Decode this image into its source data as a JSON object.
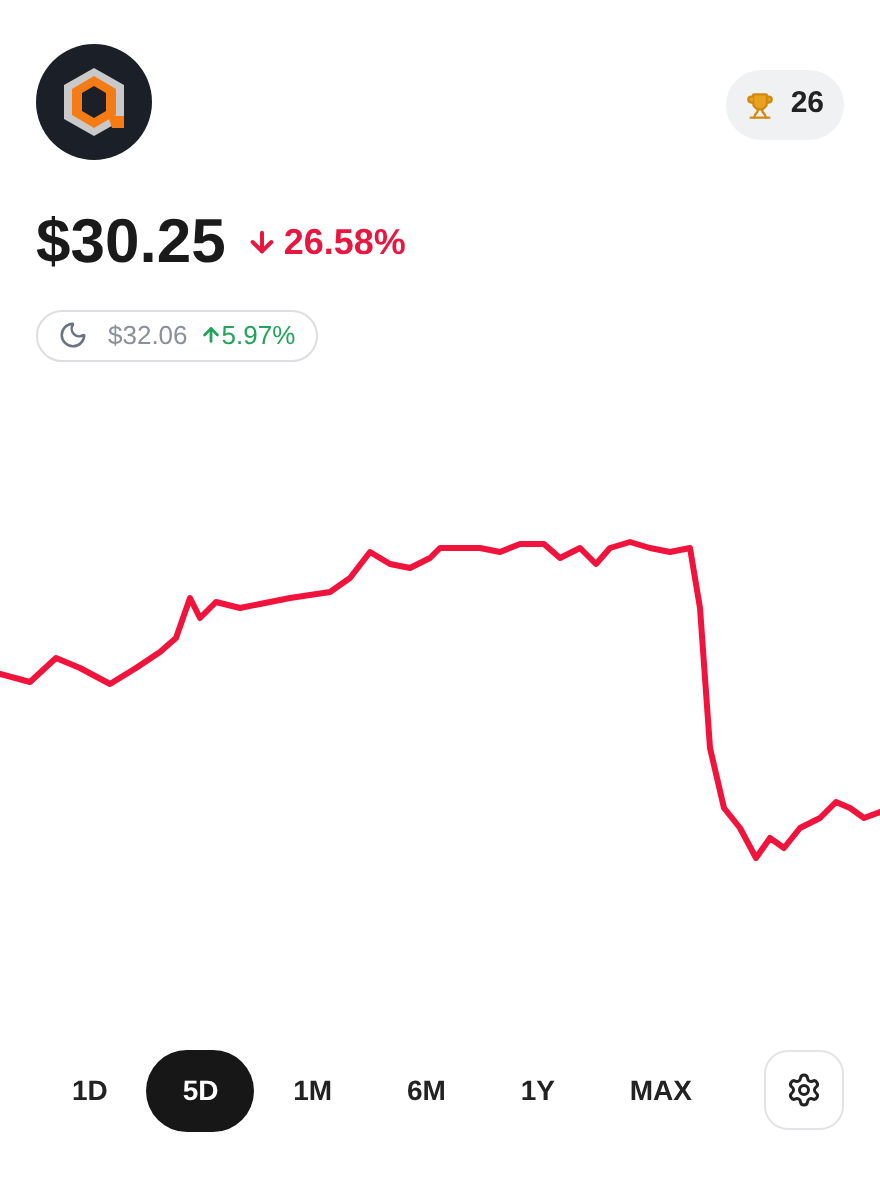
{
  "trophy": {
    "count": "26"
  },
  "price": {
    "value": "$30.25",
    "change": "26.58%",
    "falling": true
  },
  "after_hours": {
    "price": "$32.06",
    "change": "5.97%",
    "falling": false
  },
  "ranges": [
    {
      "label": "1D",
      "selected": false
    },
    {
      "label": "5D",
      "selected": true
    },
    {
      "label": "1M",
      "selected": false
    },
    {
      "label": "6M",
      "selected": false
    },
    {
      "label": "1Y",
      "selected": false
    },
    {
      "label": "MAX",
      "selected": false
    }
  ]
}
